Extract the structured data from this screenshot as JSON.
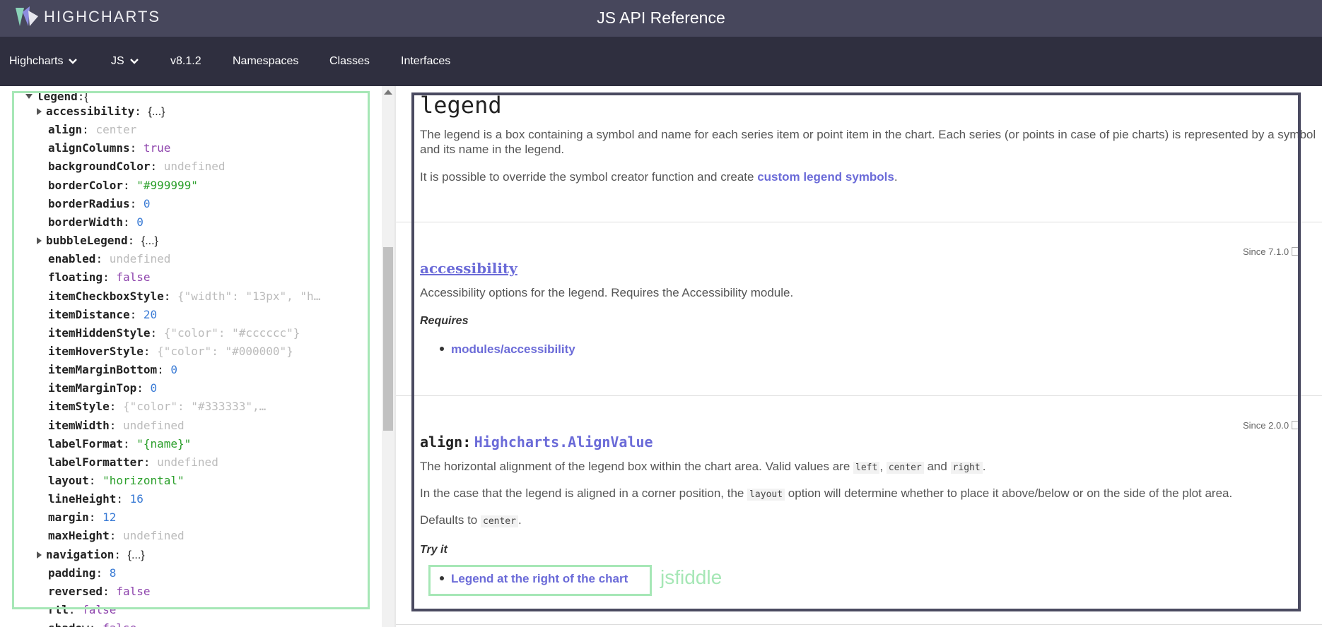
{
  "header": {
    "logo_text": "HIGHCHARTS",
    "title": "JS API Reference"
  },
  "nav": {
    "items": [
      {
        "label": "Highcharts",
        "dropdown": true
      },
      {
        "label": "JS",
        "dropdown": true
      },
      {
        "label": "v8.1.2",
        "dropdown": false
      },
      {
        "label": "Namespaces",
        "dropdown": false
      },
      {
        "label": "Classes",
        "dropdown": false
      },
      {
        "label": "Interfaces",
        "dropdown": false
      }
    ]
  },
  "sidebar": {
    "root": {
      "key": "legend",
      "brace": "{"
    },
    "items": [
      {
        "key": "accessibility",
        "value": "{...}",
        "kind": "obj"
      },
      {
        "key": "align",
        "value": "center",
        "kind": "gray"
      },
      {
        "key": "alignColumns",
        "value": "true",
        "kind": "purple"
      },
      {
        "key": "backgroundColor",
        "value": "undefined",
        "kind": "gray"
      },
      {
        "key": "borderColor",
        "value": "\"#999999\"",
        "kind": "green"
      },
      {
        "key": "borderRadius",
        "value": "0",
        "kind": "blue"
      },
      {
        "key": "borderWidth",
        "value": "0",
        "kind": "blue"
      },
      {
        "key": "bubbleLegend",
        "value": "{...}",
        "kind": "obj"
      },
      {
        "key": "enabled",
        "value": "undefined",
        "kind": "gray"
      },
      {
        "key": "floating",
        "value": "false",
        "kind": "purple"
      },
      {
        "key": "itemCheckboxStyle",
        "value": "{\"width\": \"13px\", \"h…",
        "kind": "gray"
      },
      {
        "key": "itemDistance",
        "value": "20",
        "kind": "blue"
      },
      {
        "key": "itemHiddenStyle",
        "value": "{\"color\": \"#cccccc\"}",
        "kind": "gray"
      },
      {
        "key": "itemHoverStyle",
        "value": "{\"color\": \"#000000\"}",
        "kind": "gray"
      },
      {
        "key": "itemMarginBottom",
        "value": "0",
        "kind": "blue"
      },
      {
        "key": "itemMarginTop",
        "value": "0",
        "kind": "blue"
      },
      {
        "key": "itemStyle",
        "value": "{\"color\": \"#333333\",…",
        "kind": "gray"
      },
      {
        "key": "itemWidth",
        "value": "undefined",
        "kind": "gray"
      },
      {
        "key": "labelFormat",
        "value": "\"{name}\"",
        "kind": "green"
      },
      {
        "key": "labelFormatter",
        "value": "undefined",
        "kind": "gray"
      },
      {
        "key": "layout",
        "value": "\"horizontal\"",
        "kind": "green"
      },
      {
        "key": "lineHeight",
        "value": "16",
        "kind": "blue"
      },
      {
        "key": "margin",
        "value": "12",
        "kind": "blue"
      },
      {
        "key": "maxHeight",
        "value": "undefined",
        "kind": "gray"
      },
      {
        "key": "navigation",
        "value": "{...}",
        "kind": "obj"
      },
      {
        "key": "padding",
        "value": "8",
        "kind": "blue"
      },
      {
        "key": "reversed",
        "value": "false",
        "kind": "purple"
      },
      {
        "key": "rtl",
        "value": "false",
        "kind": "purple"
      },
      {
        "key": "shadow",
        "value": "false",
        "kind": "purple"
      }
    ]
  },
  "content": {
    "title": "legend",
    "intro1": "The legend is a box containing a symbol and name for each series item or point item in the chart. Each series (or points in case of pie charts) is represented by a symbol and its name in the legend.",
    "intro2_prefix": "It is possible to override the symbol creator function and create ",
    "intro2_link": "custom legend symbols",
    "intro2_suffix": ".",
    "accessibility": {
      "since": "Since 7.1.0",
      "name": "accessibility",
      "desc": "Accessibility options for the legend. Requires the Accessibility module.",
      "requires_label": "Requires",
      "requires_link": "modules/accessibility"
    },
    "align": {
      "since": "Since 2.0.0",
      "name": "align:",
      "type": "Highcharts.AlignValue",
      "desc_prefix": "The horizontal alignment of the legend box within the chart area. Valid values are ",
      "code_left": "left",
      "code_center": "center",
      "and": " and ",
      "code_right": "right",
      "desc_suffix": ".",
      "layout_prefix": "In the case that the legend is aligned in a corner position, the ",
      "code_layout": "layout",
      "layout_suffix": " option will determine whether to place it above/below or on the side of the plot area.",
      "defaults_prefix": "Defaults to ",
      "code_default": "center",
      "defaults_suffix": ".",
      "try_label": "Try it",
      "try_link": "Legend at the right of the chart",
      "fiddle_label": "jsfiddle"
    }
  }
}
